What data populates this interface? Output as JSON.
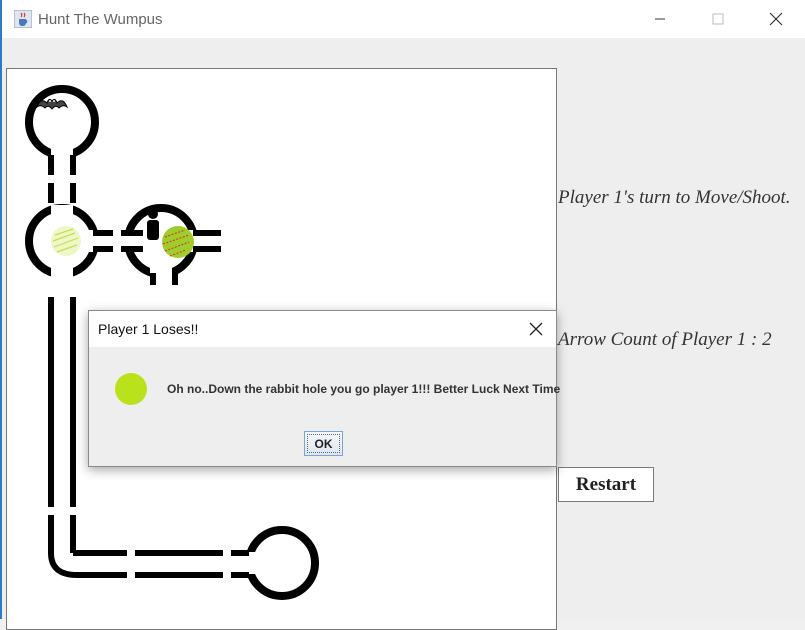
{
  "window": {
    "title": "Hunt The Wumpus",
    "icons": {
      "app": "java-cup-icon",
      "minimize": "minimize-icon",
      "maximize": "maximize-icon",
      "close": "close-icon"
    }
  },
  "board": {
    "icons": [
      "bat-icon",
      "pit-icon",
      "player-icon",
      "pit-icon"
    ]
  },
  "side_panel": {
    "turn_text": "Player 1's turn to Move/Shoot.",
    "arrow_text": "Arrow Count of Player 1 : 2",
    "restart_label": "Restart"
  },
  "dialog": {
    "title": "Player 1 Loses!!",
    "message": "Oh no..Down the rabbit hole you go player 1!!! Better Luck Next Time",
    "ok_label": "OK",
    "icon": "pit-icon"
  },
  "colors": {
    "accent_border": "#2f79c9",
    "pit": "#b9e21c",
    "pit_marks": "#d92b2b"
  }
}
